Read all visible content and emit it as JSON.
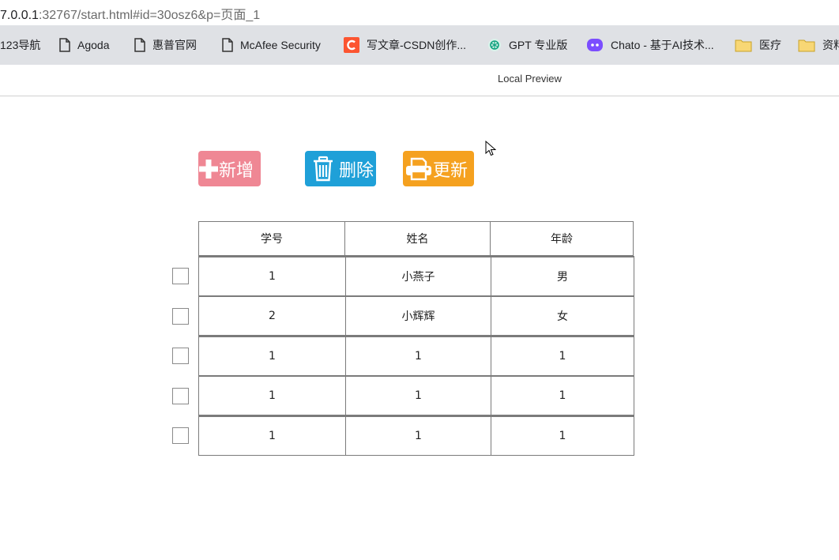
{
  "browser": {
    "url_host": "7.0.0.1",
    "url_rest": ":32767/start.html#id=30osz6&p=页面_1",
    "bookmarks": [
      {
        "label": "123导航",
        "icon": "none"
      },
      {
        "label": "Agoda",
        "icon": "page-icon"
      },
      {
        "label": "惠普官网",
        "icon": "page-icon"
      },
      {
        "label": "McAfee Security",
        "icon": "page-icon"
      },
      {
        "label": "写文章-CSDN创作...",
        "icon": "csdn-icon"
      },
      {
        "label": "GPT 专业版",
        "icon": "openai-icon"
      },
      {
        "label": "Chato - 基于AI技术...",
        "icon": "chato-icon"
      },
      {
        "label": "医疗",
        "icon": "folder-icon"
      },
      {
        "label": "资料",
        "icon": "folder-icon"
      }
    ]
  },
  "preview": {
    "title": "Local Preview"
  },
  "toolbar": {
    "add_label": "新增",
    "delete_label": "删除",
    "update_label": "更新",
    "colors": {
      "add": "#ef8794",
      "delete": "#1fa0d8",
      "update": "#f5a11f"
    }
  },
  "table": {
    "headers": [
      "学号",
      "姓名",
      "年龄"
    ],
    "rows": [
      [
        "1",
        "小燕子",
        "男"
      ],
      [
        "2",
        "小辉辉",
        "女"
      ],
      [
        "1",
        "1",
        "1"
      ],
      [
        "1",
        "1",
        "1"
      ],
      [
        "1",
        "1",
        "1"
      ]
    ]
  }
}
